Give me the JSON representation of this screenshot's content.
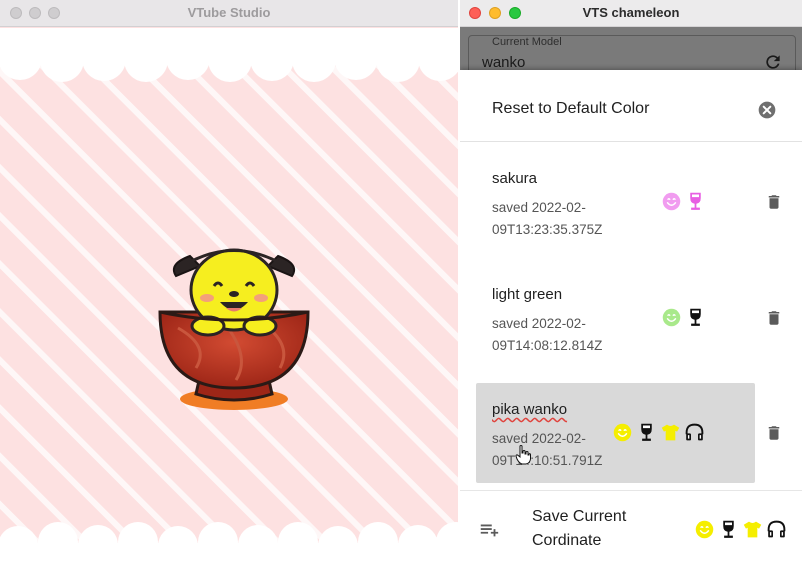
{
  "left_window": {
    "title": "VTube Studio"
  },
  "right_window": {
    "title": "VTS chameleon",
    "current_model": {
      "legend": "Current Model",
      "value": "wanko"
    },
    "reset_label": "Reset to Default Color",
    "coordinates": [
      {
        "name": "sakura",
        "saved_line1": "saved 2022-02-",
        "saved_line2": "09T13:23:35.375Z",
        "icons": [
          "face-icon",
          "wineglass-icon"
        ],
        "colors": [
          "#f19cf0",
          "#e85fe3"
        ],
        "selected": false
      },
      {
        "name": "light green",
        "saved_line1": "saved 2022-02-",
        "saved_line2": "09T14:08:12.814Z",
        "icons": [
          "face-icon",
          "wineglass-icon"
        ],
        "colors": [
          "#a9e98b",
          "#111111"
        ],
        "selected": false
      },
      {
        "name": "pika wanko",
        "saved_line1": "saved 2022-02-",
        "saved_line2": "09T14:10:51.791Z",
        "icons": [
          "face-icon",
          "wineglass-icon",
          "shirt-icon",
          "headphones-icon"
        ],
        "colors": [
          "#f5ee00",
          "#111111",
          "#f5ee00",
          "#111111"
        ],
        "selected": true
      }
    ],
    "save_label": "Save Current Cordinate",
    "save_icons": [
      "face-icon",
      "wineglass-icon",
      "shirt-icon",
      "headphones-icon"
    ],
    "save_colors": [
      "#f5ee00",
      "#111111",
      "#f5ee00",
      "#111111"
    ]
  },
  "colors": {
    "stage_bg": "#fde1e1",
    "stripe": "#ffffff",
    "accent_yellow": "#f5ee00",
    "selected_row": "#d9d9d9"
  }
}
